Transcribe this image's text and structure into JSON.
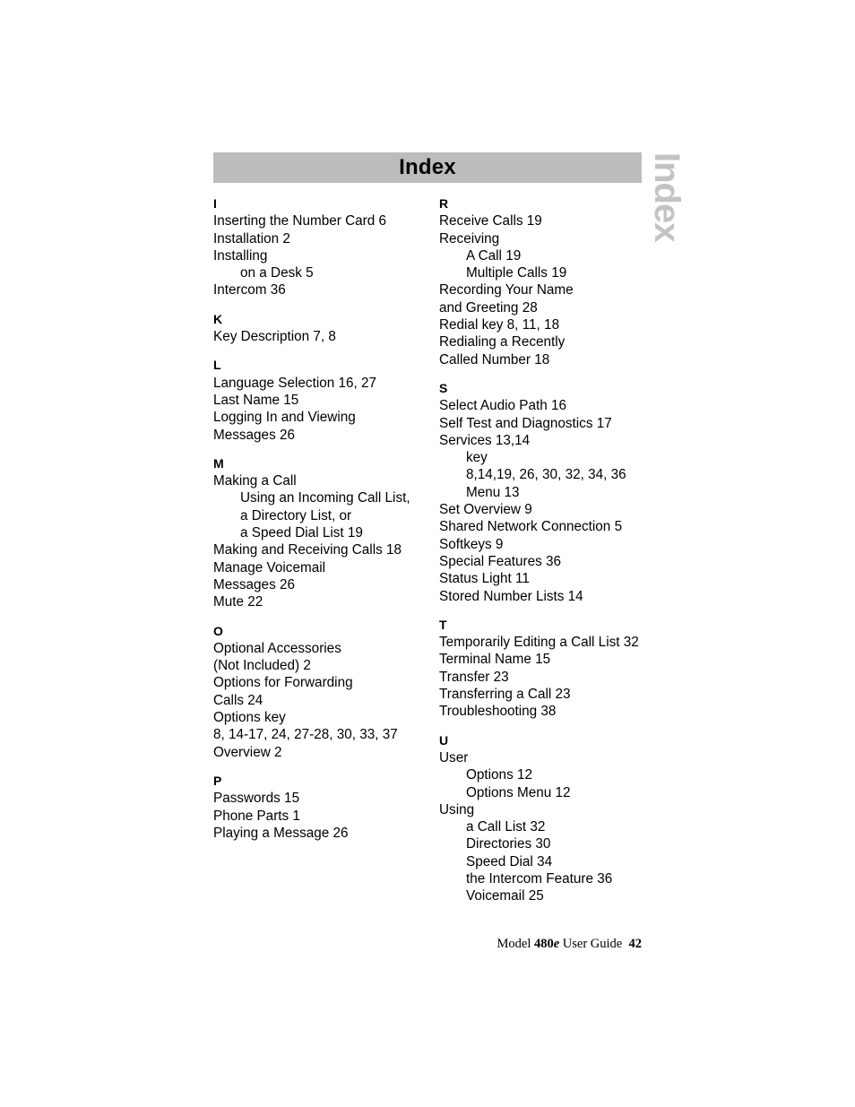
{
  "page": {
    "title": "Index",
    "side_tab_label": "Index",
    "colors": {
      "header_bar": "#bcbcbc",
      "side_tab_text": "#c3c3c3",
      "text": "#000000",
      "background": "#ffffff"
    }
  },
  "index": {
    "left_column": [
      {
        "letter": "I",
        "entries": [
          {
            "text": "Inserting the Number Card 6",
            "sub": false
          },
          {
            "text": "Installation 2",
            "sub": false
          },
          {
            "text": "Installing",
            "sub": false
          },
          {
            "text": "on a Desk 5",
            "sub": true
          },
          {
            "text": "Intercom 36",
            "sub": false
          }
        ]
      },
      {
        "letter": "K",
        "entries": [
          {
            "text": "Key Description 7, 8",
            "sub": false
          }
        ]
      },
      {
        "letter": "L",
        "entries": [
          {
            "text": "Language Selection 16, 27",
            "sub": false
          },
          {
            "text": "Last Name 15",
            "sub": false
          },
          {
            "text": "Logging In and Viewing",
            "sub": false
          },
          {
            "text": "Messages 26",
            "sub": false
          }
        ]
      },
      {
        "letter": "M",
        "entries": [
          {
            "text": "Making a Call",
            "sub": false
          },
          {
            "text": "Using an Incoming Call List,",
            "sub": true
          },
          {
            "text": "a Directory List, or",
            "sub": true
          },
          {
            "text": "a Speed Dial List 19",
            "sub": true
          },
          {
            "text": "Making and Receiving Calls 18",
            "sub": false
          },
          {
            "text": "Manage Voicemail",
            "sub": false
          },
          {
            "text": "Messages 26",
            "sub": false
          },
          {
            "text": "Mute 22",
            "sub": false
          }
        ]
      },
      {
        "letter": "O",
        "entries": [
          {
            "text": "Optional Accessories",
            "sub": false
          },
          {
            "text": "(Not Included) 2",
            "sub": false
          },
          {
            "text": "Options for Forwarding",
            "sub": false
          },
          {
            "text": "Calls 24",
            "sub": false
          },
          {
            "text": "Options key",
            "sub": false
          },
          {
            "text": "8, 14-17, 24, 27-28, 30, 33, 37",
            "sub": false
          },
          {
            "text": "Overview 2",
            "sub": false
          }
        ]
      },
      {
        "letter": "P",
        "entries": [
          {
            "text": "Passwords 15",
            "sub": false
          },
          {
            "text": "Phone Parts 1",
            "sub": false
          },
          {
            "text": "Playing a Message 26",
            "sub": false
          }
        ]
      }
    ],
    "right_column": [
      {
        "letter": "R",
        "entries": [
          {
            "text": "Receive Calls 19",
            "sub": false
          },
          {
            "text": "Receiving",
            "sub": false
          },
          {
            "text": "A Call 19",
            "sub": true
          },
          {
            "text": "Multiple Calls 19",
            "sub": true
          },
          {
            "text": "Recording Your Name",
            "sub": false
          },
          {
            "text": "and Greeting 28",
            "sub": false
          },
          {
            "text": "Redial key 8, 11, 18",
            "sub": false
          },
          {
            "text": "Redialing a Recently",
            "sub": false
          },
          {
            "text": "Called Number 18",
            "sub": false
          }
        ]
      },
      {
        "letter": "S",
        "entries": [
          {
            "text": "Select Audio Path 16",
            "sub": false
          },
          {
            "text": "Self Test and Diagnostics 17",
            "sub": false
          },
          {
            "text": "Services 13,14",
            "sub": false
          },
          {
            "text": "key",
            "sub": true
          },
          {
            "text": "8,14,19, 26, 30, 32, 34, 36",
            "sub": true
          },
          {
            "text": "Menu 13",
            "sub": true
          },
          {
            "text": "Set Overview 9",
            "sub": false
          },
          {
            "text": "Shared Network Connection 5",
            "sub": false
          },
          {
            "text": "Softkeys 9",
            "sub": false
          },
          {
            "text": "Special Features 36",
            "sub": false
          },
          {
            "text": "Status Light 11",
            "sub": false
          },
          {
            "text": "Stored Number Lists 14",
            "sub": false
          }
        ]
      },
      {
        "letter": "T",
        "entries": [
          {
            "text": "Temporarily Editing a Call List 32",
            "sub": false
          },
          {
            "text": "Terminal Name 15",
            "sub": false
          },
          {
            "text": "Transfer 23",
            "sub": false
          },
          {
            "text": "Transferring a Call 23",
            "sub": false
          },
          {
            "text": "Troubleshooting 38",
            "sub": false
          }
        ]
      },
      {
        "letter": "U",
        "entries": [
          {
            "text": "User",
            "sub": false
          },
          {
            "text": "Options 12",
            "sub": true
          },
          {
            "text": "Options Menu 12",
            "sub": true
          },
          {
            "text": "Using",
            "sub": false
          },
          {
            "text": "a Call List 32",
            "sub": true
          },
          {
            "text": "Directories 30",
            "sub": true
          },
          {
            "text": "Speed Dial 34",
            "sub": true
          },
          {
            "text": "the Intercom Feature 36",
            "sub": true
          },
          {
            "text": "Voicemail 25",
            "sub": true
          }
        ]
      }
    ]
  },
  "footer": {
    "prefix": "Model ",
    "model_number": "480",
    "model_suffix": "e",
    "guide_label": " User Guide",
    "page_number": "42"
  }
}
